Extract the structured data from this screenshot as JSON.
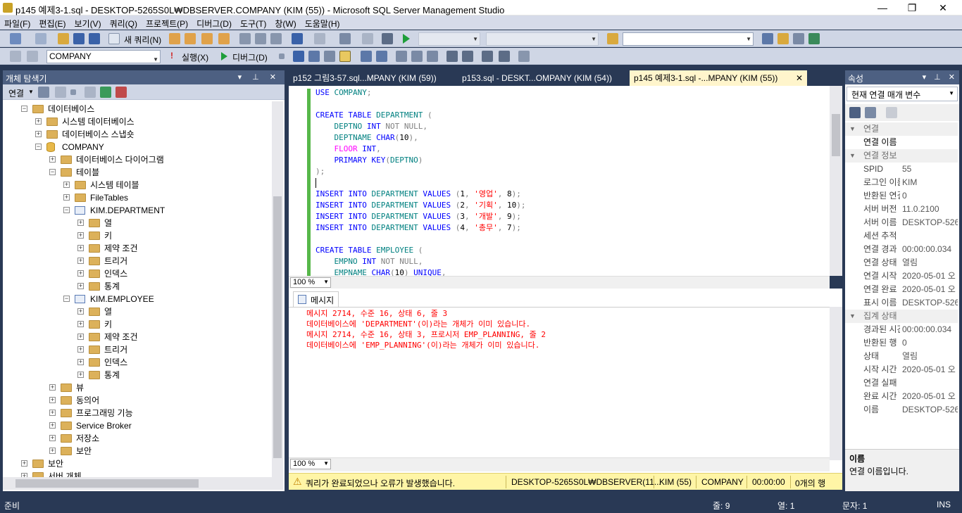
{
  "window": {
    "title": "p145 예제3-1.sql - DESKTOP-5265S0L₩DBSERVER.COMPANY (KIM (55)) - Microsoft SQL Server Management Studio",
    "min": "—",
    "max": "❐",
    "close": "✕"
  },
  "menu": [
    "파일(F)",
    "편집(E)",
    "보기(V)",
    "쿼리(Q)",
    "프로젝트(P)",
    "디버그(D)",
    "도구(T)",
    "창(W)",
    "도움말(H)"
  ],
  "toolbar1": {
    "new_query": "새 쿼리(N)"
  },
  "toolbar2": {
    "database": "COMPANY",
    "execute": "실행(X)",
    "debug": "디버그(D)"
  },
  "object_explorer": {
    "title": "개체 탐색기",
    "connect": "연결",
    "nodes": [
      {
        "label": "데이터베이스",
        "sign": "−"
      },
      {
        "label": "시스템 데이터베이스",
        "sign": "+"
      },
      {
        "label": "데이터베이스 스냅숏",
        "sign": "+"
      },
      {
        "label": "COMPANY",
        "sign": "−"
      },
      {
        "label": "데이터베이스 다이어그램",
        "sign": "+"
      },
      {
        "label": "테이블",
        "sign": "−"
      },
      {
        "label": "시스템 테이블",
        "sign": "+"
      },
      {
        "label": "FileTables",
        "sign": "+"
      },
      {
        "label": "KIM.DEPARTMENT",
        "sign": "−"
      },
      {
        "label": "열",
        "sign": "+"
      },
      {
        "label": "키",
        "sign": "+"
      },
      {
        "label": "제약 조건",
        "sign": "+"
      },
      {
        "label": "트리거",
        "sign": "+"
      },
      {
        "label": "인덱스",
        "sign": "+"
      },
      {
        "label": "통계",
        "sign": "+"
      },
      {
        "label": "KIM.EMPLOYEE",
        "sign": "−"
      },
      {
        "label": "열",
        "sign": "+"
      },
      {
        "label": "키",
        "sign": "+"
      },
      {
        "label": "제약 조건",
        "sign": "+"
      },
      {
        "label": "트리거",
        "sign": "+"
      },
      {
        "label": "인덱스",
        "sign": "+"
      },
      {
        "label": "통계",
        "sign": "+"
      },
      {
        "label": "뷰",
        "sign": "+"
      },
      {
        "label": "동의어",
        "sign": "+"
      },
      {
        "label": "프로그래밍 기능",
        "sign": "+"
      },
      {
        "label": "Service Broker",
        "sign": "+"
      },
      {
        "label": "저장소",
        "sign": "+"
      },
      {
        "label": "보안",
        "sign": "+"
      },
      {
        "label": "보안",
        "sign": "+"
      },
      {
        "label": "서버 개체",
        "sign": "+"
      }
    ]
  },
  "tabs": [
    {
      "label": "p152 그림3-57.sql...MPANY (KIM (59))"
    },
    {
      "label": "p153.sql - DESKT...OMPANY (KIM (54))"
    },
    {
      "label": "p145 예제3-1.sql -...MPANY (KIM (55))",
      "close": "✕"
    }
  ],
  "editor": {
    "lines": [
      [
        {
          "t": "USE ",
          "c": "kw"
        },
        {
          "t": "COMPANY",
          "c": "tl"
        },
        {
          "t": ";",
          "c": "gr"
        }
      ],
      [],
      [
        {
          "t": "CREATE TABLE ",
          "c": "kw"
        },
        {
          "t": "DEPARTMENT",
          "c": "tl"
        },
        {
          "t": " (",
          "c": "gr"
        }
      ],
      [
        {
          "t": "    DEPTNO ",
          "c": "tl"
        },
        {
          "t": "INT ",
          "c": "kw"
        },
        {
          "t": "NOT NULL,",
          "c": "gr"
        }
      ],
      [
        {
          "t": "    DEPTNAME ",
          "c": "tl"
        },
        {
          "t": "CHAR",
          "c": "kw"
        },
        {
          "t": "(",
          "c": "gr"
        },
        {
          "t": "10",
          "c": "bl"
        },
        {
          "t": "),",
          "c": "gr"
        }
      ],
      [
        {
          "t": "    FLOOR ",
          "c": "pk"
        },
        {
          "t": "INT",
          "c": "kw"
        },
        {
          "t": ",",
          "c": "gr"
        }
      ],
      [
        {
          "t": "    PRIMARY KEY",
          "c": "kw"
        },
        {
          "t": "(",
          "c": "gr"
        },
        {
          "t": "DEPTNO",
          "c": "tl"
        },
        {
          "t": ")",
          "c": "gr"
        }
      ],
      [
        {
          "t": ");",
          "c": "gr"
        }
      ],
      [],
      [
        {
          "t": "INSERT INTO ",
          "c": "kw"
        },
        {
          "t": "DEPARTMENT ",
          "c": "tl"
        },
        {
          "t": "VALUES ",
          "c": "kw"
        },
        {
          "t": "(",
          "c": "gr"
        },
        {
          "t": "1",
          "c": "bl"
        },
        {
          "t": ", ",
          "c": "gr"
        },
        {
          "t": "'영업'",
          "c": "rd"
        },
        {
          "t": ", ",
          "c": "gr"
        },
        {
          "t": "8",
          "c": "bl"
        },
        {
          "t": ");",
          "c": "gr"
        }
      ],
      [
        {
          "t": "INSERT INTO ",
          "c": "kw"
        },
        {
          "t": "DEPARTMENT ",
          "c": "tl"
        },
        {
          "t": "VALUES ",
          "c": "kw"
        },
        {
          "t": "(",
          "c": "gr"
        },
        {
          "t": "2",
          "c": "bl"
        },
        {
          "t": ", ",
          "c": "gr"
        },
        {
          "t": "'기획'",
          "c": "rd"
        },
        {
          "t": ", ",
          "c": "gr"
        },
        {
          "t": "10",
          "c": "bl"
        },
        {
          "t": ");",
          "c": "gr"
        }
      ],
      [
        {
          "t": "INSERT INTO ",
          "c": "kw"
        },
        {
          "t": "DEPARTMENT ",
          "c": "tl"
        },
        {
          "t": "VALUES ",
          "c": "kw"
        },
        {
          "t": "(",
          "c": "gr"
        },
        {
          "t": "3",
          "c": "bl"
        },
        {
          "t": ", ",
          "c": "gr"
        },
        {
          "t": "'개발'",
          "c": "rd"
        },
        {
          "t": ", ",
          "c": "gr"
        },
        {
          "t": "9",
          "c": "bl"
        },
        {
          "t": ");",
          "c": "gr"
        }
      ],
      [
        {
          "t": "INSERT INTO ",
          "c": "kw"
        },
        {
          "t": "DEPARTMENT ",
          "c": "tl"
        },
        {
          "t": "VALUES ",
          "c": "kw"
        },
        {
          "t": "(",
          "c": "gr"
        },
        {
          "t": "4",
          "c": "bl"
        },
        {
          "t": ", ",
          "c": "gr"
        },
        {
          "t": "'총무'",
          "c": "rd"
        },
        {
          "t": ", ",
          "c": "gr"
        },
        {
          "t": "7",
          "c": "bl"
        },
        {
          "t": ");",
          "c": "gr"
        }
      ],
      [],
      [
        {
          "t": "CREATE TABLE ",
          "c": "kw"
        },
        {
          "t": "EMPLOYEE",
          "c": "tl"
        },
        {
          "t": " (",
          "c": "gr"
        }
      ],
      [
        {
          "t": "    EMPNO ",
          "c": "tl"
        },
        {
          "t": "INT ",
          "c": "kw"
        },
        {
          "t": "NOT NULL,",
          "c": "gr"
        }
      ],
      [
        {
          "t": "    EMPNAME ",
          "c": "tl"
        },
        {
          "t": "CHAR",
          "c": "kw"
        },
        {
          "t": "(",
          "c": "gr"
        },
        {
          "t": "10",
          "c": "bl"
        },
        {
          "t": ") ",
          "c": "gr"
        },
        {
          "t": "UNIQUE",
          "c": "kw"
        },
        {
          "t": ",",
          "c": "gr"
        }
      ]
    ],
    "zoom": "100 %"
  },
  "messages": {
    "tab": "메시지",
    "lines": [
      "메시지 2714, 수준 16, 상태 6, 줄 3",
      "데이터베이스에 'DEPARTMENT'(이)라는 개체가 이미 있습니다.",
      "메시지 2714, 수준 16, 상태 3, 프로시저 EMP_PLANNING, 줄 2",
      "데이터베이스에 'EMP_PLANNING'(이)라는 개체가 이미 있습니다."
    ],
    "zoom": "100 %"
  },
  "query_status": {
    "text": "쿼리가 완료되었으나 오류가 발생했습니다.",
    "server": "DESKTOP-5265S0L₩DBSERVER(11...",
    "user": "KIM (55)",
    "database": "COMPANY",
    "elapsed": "00:00:00",
    "rows": "0개의 행"
  },
  "properties": {
    "title": "속성",
    "selector": "현재 연결 매개 변수",
    "cat1": "연결",
    "cat2": "연결 정보",
    "cat3": "집계 상태",
    "rows1": [
      {
        "k": "연결 이름",
        "v": ""
      }
    ],
    "rows2": [
      {
        "k": "SPID",
        "v": "55"
      },
      {
        "k": "로그인 이름",
        "v": "KIM"
      },
      {
        "k": "반환된 연결",
        "v": "0"
      },
      {
        "k": "서버 버전",
        "v": "11.0.2100"
      },
      {
        "k": "서버 이름",
        "v": "DESKTOP-526"
      },
      {
        "k": "세션 추적",
        "v": ""
      },
      {
        "k": "연결 경과",
        "v": "00:00:00.034"
      },
      {
        "k": "연결 상태",
        "v": "열림"
      },
      {
        "k": "연결 시작",
        "v": "2020-05-01 오"
      },
      {
        "k": "연결 완료",
        "v": "2020-05-01 오"
      },
      {
        "k": "표시 이름",
        "v": "DESKTOP-526"
      }
    ],
    "rows3": [
      {
        "k": "경과된 시간",
        "v": "00:00:00.034"
      },
      {
        "k": "반환된 행",
        "v": "0"
      },
      {
        "k": "상태",
        "v": "열림"
      },
      {
        "k": "시작 시간",
        "v": "2020-05-01 오"
      },
      {
        "k": "연결 실패",
        "v": ""
      },
      {
        "k": "완료 시간",
        "v": "2020-05-01 오"
      },
      {
        "k": "이름",
        "v": "DESKTOP-526"
      }
    ],
    "desc_title": "이름",
    "desc_text": "연결 이름입니다."
  },
  "statusbar": {
    "ready": "준비",
    "line": "줄: 9",
    "col": "열: 1",
    "ch": "문자: 1",
    "ins": "INS"
  }
}
